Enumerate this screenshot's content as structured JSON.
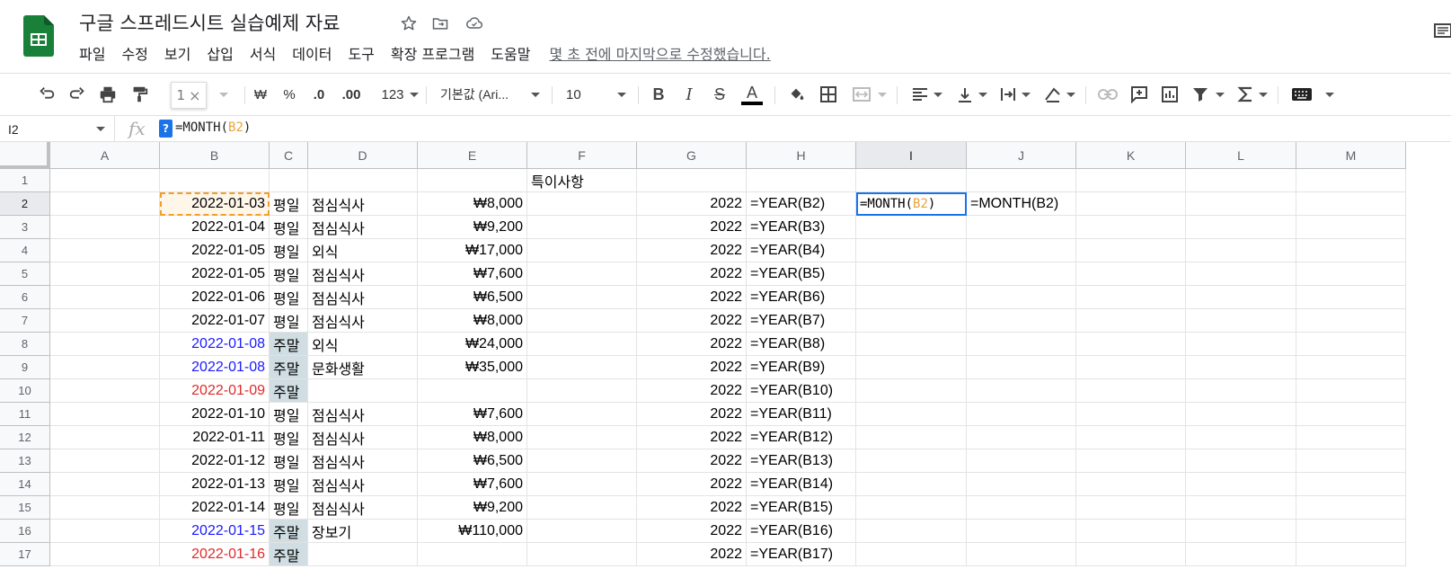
{
  "header": {
    "title": "구글 스프레드시트 실습예제 자료",
    "last_edit": "몇 초 전에 마지막으로 수정했습니다.",
    "menu": [
      "파일",
      "수정",
      "보기",
      "삽입",
      "서식",
      "데이터",
      "도구",
      "확장 프로그램",
      "도움말"
    ],
    "accent_color": "#188038"
  },
  "toolbar": {
    "currency": "₩",
    "percent": "%",
    "decrease_decimal": ".0",
    "increase_decimal": ".00",
    "number_format": "123",
    "font_name": "기본값 (Ari...",
    "font_size": "10",
    "bold": "B",
    "italic": "I",
    "strike": "S",
    "text_color": "A",
    "zoom_tooltip": "1"
  },
  "formula_bar": {
    "name_box": "I2",
    "fx": "fx",
    "help": "?",
    "formula_prefix": "=MONTH(",
    "formula_ref": "B2",
    "formula_suffix": ")"
  },
  "grid": {
    "columns": [
      "A",
      "B",
      "C",
      "D",
      "E",
      "F",
      "G",
      "H",
      "I",
      "J",
      "K",
      "L",
      "M"
    ],
    "active_column": "I",
    "active_row": "2",
    "row1_F": "특이사항",
    "rows": [
      {
        "num": "2",
        "date": "2022-01-03",
        "date_color": "black",
        "day": "평일",
        "item": "점심식사",
        "amount": "₩8,000",
        "year": "2022",
        "formula": "=YEAR(B2)"
      },
      {
        "num": "3",
        "date": "2022-01-04",
        "date_color": "black",
        "day": "평일",
        "item": "점심식사",
        "amount": "₩9,200",
        "year": "2022",
        "formula": "=YEAR(B3)"
      },
      {
        "num": "4",
        "date": "2022-01-05",
        "date_color": "black",
        "day": "평일",
        "item": "외식",
        "amount": "₩17,000",
        "year": "2022",
        "formula": "=YEAR(B4)"
      },
      {
        "num": "5",
        "date": "2022-01-05",
        "date_color": "black",
        "day": "평일",
        "item": "점심식사",
        "amount": "₩7,600",
        "year": "2022",
        "formula": "=YEAR(B5)"
      },
      {
        "num": "6",
        "date": "2022-01-06",
        "date_color": "black",
        "day": "평일",
        "item": "점심식사",
        "amount": "₩6,500",
        "year": "2022",
        "formula": "=YEAR(B6)"
      },
      {
        "num": "7",
        "date": "2022-01-07",
        "date_color": "black",
        "day": "평일",
        "item": "점심식사",
        "amount": "₩8,000",
        "year": "2022",
        "formula": "=YEAR(B7)"
      },
      {
        "num": "8",
        "date": "2022-01-08",
        "date_color": "blue",
        "day": "주말",
        "item": "외식",
        "amount": "₩24,000",
        "year": "2022",
        "formula": "=YEAR(B8)"
      },
      {
        "num": "9",
        "date": "2022-01-08",
        "date_color": "blue",
        "day": "주말",
        "item": "문화생활",
        "amount": "₩35,000",
        "year": "2022",
        "formula": "=YEAR(B9)"
      },
      {
        "num": "10",
        "date": "2022-01-09",
        "date_color": "red",
        "day": "주말",
        "item": "",
        "amount": "",
        "year": "2022",
        "formula": "=YEAR(B10)"
      },
      {
        "num": "11",
        "date": "2022-01-10",
        "date_color": "black",
        "day": "평일",
        "item": "점심식사",
        "amount": "₩7,600",
        "year": "2022",
        "formula": "=YEAR(B11)"
      },
      {
        "num": "12",
        "date": "2022-01-11",
        "date_color": "black",
        "day": "평일",
        "item": "점심식사",
        "amount": "₩8,000",
        "year": "2022",
        "formula": "=YEAR(B12)"
      },
      {
        "num": "13",
        "date": "2022-01-12",
        "date_color": "black",
        "day": "평일",
        "item": "점심식사",
        "amount": "₩6,500",
        "year": "2022",
        "formula": "=YEAR(B13)"
      },
      {
        "num": "14",
        "date": "2022-01-13",
        "date_color": "black",
        "day": "평일",
        "item": "점심식사",
        "amount": "₩7,600",
        "year": "2022",
        "formula": "=YEAR(B14)"
      },
      {
        "num": "15",
        "date": "2022-01-14",
        "date_color": "black",
        "day": "평일",
        "item": "점심식사",
        "amount": "₩9,200",
        "year": "2022",
        "formula": "=YEAR(B15)"
      },
      {
        "num": "16",
        "date": "2022-01-15",
        "date_color": "blue",
        "day": "주말",
        "item": "장보기",
        "amount": "₩110,000",
        "year": "2022",
        "formula": "=YEAR(B16)"
      },
      {
        "num": "17",
        "date": "2022-01-16",
        "date_color": "red",
        "day": "주말",
        "item": "",
        "amount": "",
        "year": "2022",
        "formula": "=YEAR(B17)"
      }
    ],
    "active_cell_text": "=MONTH(",
    "active_cell_ref": "B2",
    "active_cell_close": ")",
    "J2": "=MONTH(B2)"
  }
}
